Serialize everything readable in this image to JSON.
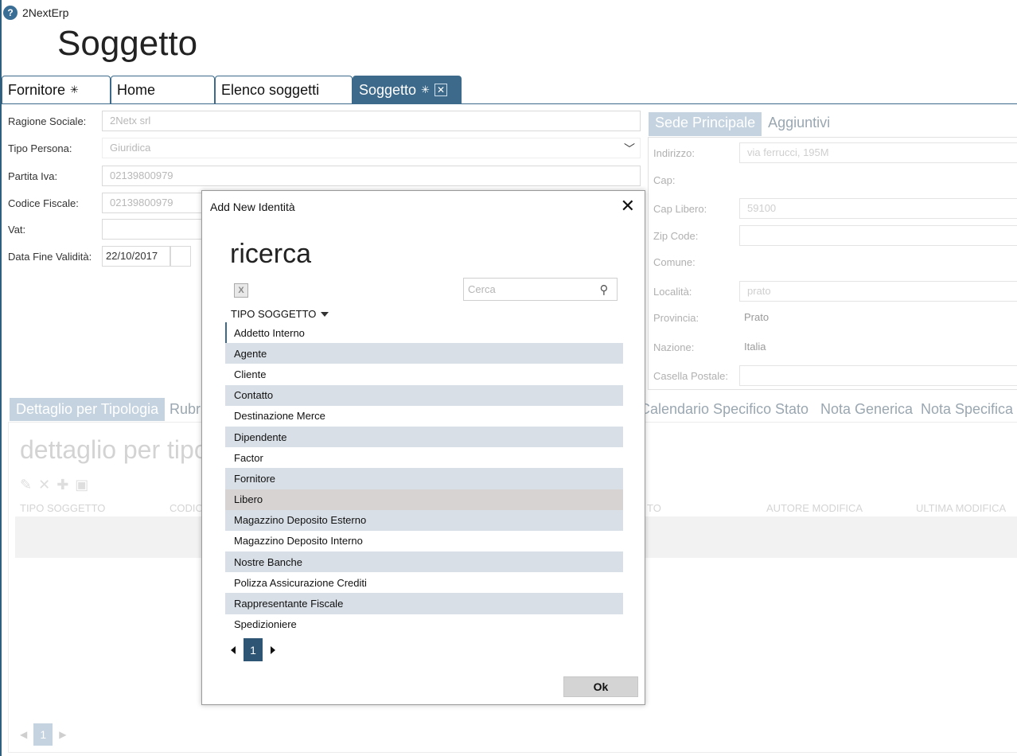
{
  "app": {
    "title": "2NextErp",
    "icon_glyph": "?"
  },
  "page": {
    "title": "Soggetto"
  },
  "tabs": [
    {
      "label": "Fornitore",
      "pin": "✳"
    },
    {
      "label": "Home"
    },
    {
      "label": "Elenco soggetti"
    },
    {
      "label": "Soggetto",
      "pin": "✳",
      "close": "✕"
    }
  ],
  "form": {
    "ragione_sociale": {
      "label": "Ragione Sociale:",
      "value": "2Netx srl"
    },
    "tipo_persona": {
      "label": "Tipo Persona:",
      "value": "Giuridica"
    },
    "partita_iva": {
      "label": "Partita Iva:",
      "value": "02139800979"
    },
    "codice_fiscale": {
      "label": "Codice Fiscale:",
      "value": "02139800979"
    },
    "vat": {
      "label": "Vat:",
      "value": ""
    },
    "data_fine_validita": {
      "label": "Data Fine Validità:",
      "value": "22/10/2017"
    }
  },
  "right_tabs": [
    "Sede Principale",
    "Aggiuntivi"
  ],
  "address": {
    "indirizzo": {
      "label": "Indirizzo:",
      "value": "via ferrucci, 195M"
    },
    "cap": {
      "label": "Cap:"
    },
    "cap_libero": {
      "label": "Cap Libero:",
      "value": "59100"
    },
    "zip_code": {
      "label": "Zip Code:",
      "value": ""
    },
    "comune": {
      "label": "Comune:"
    },
    "localita": {
      "label": "Località:",
      "value": "prato"
    },
    "provincia": {
      "label": "Provincia:",
      "value": "Prato"
    },
    "nazione": {
      "label": "Nazione:",
      "value": "Italia"
    },
    "casella_postale": {
      "label": "Casella Postale:",
      "value": ""
    }
  },
  "bottom_tabs": [
    "Dettaglio per Tipologia",
    "Rubri",
    "Calendario Specifico",
    "Stato",
    "Nota Generica",
    "Nota Specifica"
  ],
  "detail": {
    "title": "dettaglio per tipo",
    "columns": [
      "TIPO SOGGETTO",
      "CODIC",
      "TO",
      "AUTORE MODIFICA",
      "ULTIMA MODIFICA"
    ],
    "page": "1"
  },
  "dialog": {
    "title": "Add New Identità",
    "close": "✕",
    "heading": "ricerca",
    "excel_glyph": "X",
    "search_placeholder": "Cerca",
    "column_header": "TIPO SOGGETTO",
    "items": [
      "Addetto Interno",
      "Agente",
      "Cliente",
      "Contatto",
      "Destinazione Merce",
      "Dipendente",
      "Factor",
      "Fornitore",
      "Libero",
      "Magazzino Deposito Esterno",
      "Magazzino Deposito Interno",
      "Nostre Banche",
      "Polizza Assicurazione Crediti",
      "Rappresentante Fiscale",
      "Spedizioniere"
    ],
    "current_page": "1",
    "ok_label": "Ok"
  }
}
